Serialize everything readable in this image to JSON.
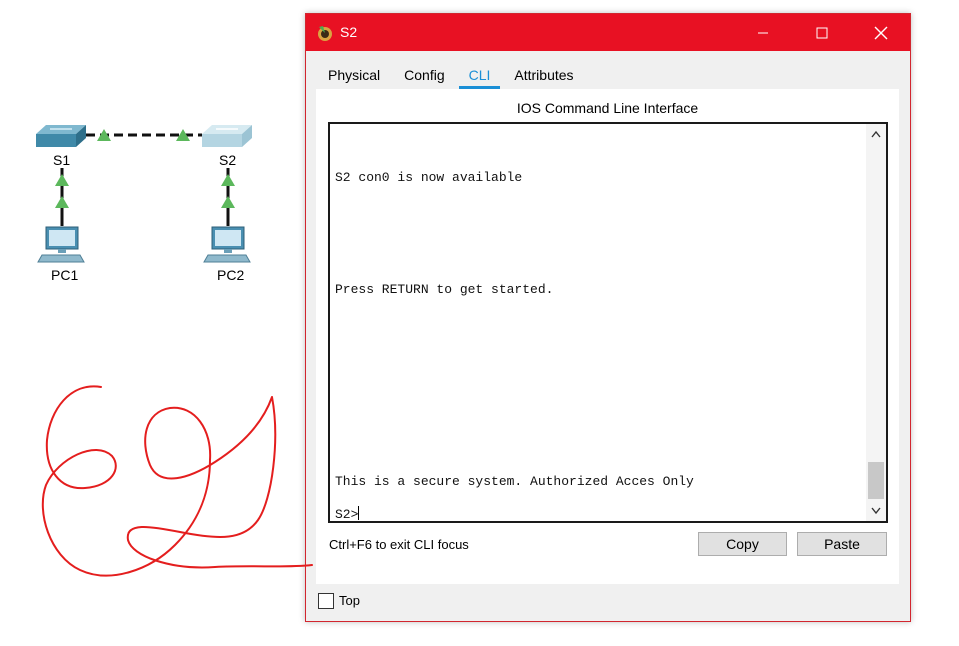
{
  "topology": {
    "devices": [
      {
        "id": "s1",
        "label": "S1",
        "type": "switch-icon"
      },
      {
        "id": "s2",
        "label": "S2",
        "type": "switch-icon"
      },
      {
        "id": "pc1",
        "label": "PC1",
        "type": "pc-icon"
      },
      {
        "id": "pc2",
        "label": "PC2",
        "type": "pc-icon"
      }
    ],
    "link_status_color": "#5cb85c"
  },
  "window": {
    "title": "S2",
    "accent": "#e81123",
    "tabs": [
      {
        "label": "Physical"
      },
      {
        "label": "Config"
      },
      {
        "label": "CLI",
        "active": true
      },
      {
        "label": "Attributes"
      }
    ],
    "panel_title": "IOS Command Line Interface",
    "console_lines": [
      "S2 con0 is now available",
      "Press RETURN to get started.",
      "This is a secure system. Authorized Acces Only",
      "S2>"
    ],
    "hint": "Ctrl+F6 to exit CLI focus",
    "copy_label": "Copy",
    "paste_label": "Paste",
    "top_label": "Top",
    "top_checked": false
  }
}
